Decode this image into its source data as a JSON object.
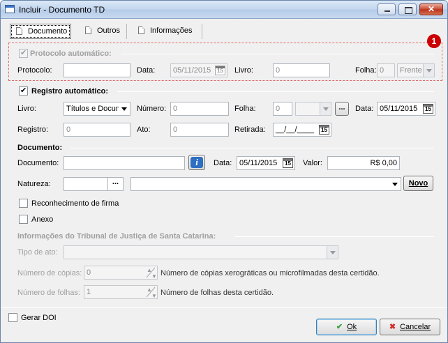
{
  "window": {
    "title": "Incluir - Documento TD"
  },
  "tabs": [
    {
      "label": "Documento"
    },
    {
      "label": "Outros"
    },
    {
      "label": "Informações"
    }
  ],
  "badge": "1",
  "protocolo": {
    "section_label": "Protocolo automático:",
    "checked": true,
    "protocolo_label": "Protocolo:",
    "protocolo_value": "",
    "data_label": "Data:",
    "data_value": "05/11/2015",
    "livro_label": "Livro:",
    "livro_value": "0",
    "folha_label": "Folha:",
    "folha_value": "0",
    "frente_value": "Frente"
  },
  "registro": {
    "section_label": "Registro automático:",
    "checked": true,
    "livro_label": "Livro:",
    "livro_value": "Títulos e Docum",
    "numero_label": "Número:",
    "numero_value": "0",
    "folha_label": "Folha:",
    "folha_value": "0",
    "folha_select": "",
    "ellipsis": "...",
    "data_label": "Data:",
    "data_value": "05/11/2015",
    "registro_label": "Registro:",
    "registro_value": "0",
    "ato_label": "Ato:",
    "ato_value": "0",
    "retirada_label": "Retirada:",
    "retirada_value": "__/__/____"
  },
  "documento": {
    "section_label": "Documento:",
    "documento_label": "Documento:",
    "documento_value": "",
    "info_glyph": "i",
    "data_label": "Data:",
    "data_value": "05/11/2015",
    "valor_label": "Valor:",
    "valor_value": "R$ 0,00",
    "natureza_label": "Natureza:",
    "natureza_code": "",
    "natureza_ellipsis": "...",
    "natureza_desc": "",
    "novo_label": "Novo",
    "reconhecimento_label": "Reconhecimento de firma",
    "anexo_label": "Anexo"
  },
  "tjsc": {
    "section_label": "Informações do Tribunal de Justiça de Santa Catarina:",
    "tipo_label": "Tipo de ato:",
    "tipo_value": "",
    "copias_label": "Número de cópias:",
    "copias_value": "0",
    "copias_desc": "Número de cópias xerográticas ou microfilmadas desta certidão.",
    "folhas_label": "Número de folhas:",
    "folhas_value": "1",
    "folhas_desc": "Número de folhas desta certidão."
  },
  "footer": {
    "gerar_doi_label": "Gerar DOI",
    "ok_label": "Ok",
    "cancel_label": "Cancelar"
  },
  "colors": {
    "badge": "#cc0000",
    "info_button": "#2f6fc2",
    "ok_check": "#3aa33a",
    "cancel_x": "#d03030"
  }
}
